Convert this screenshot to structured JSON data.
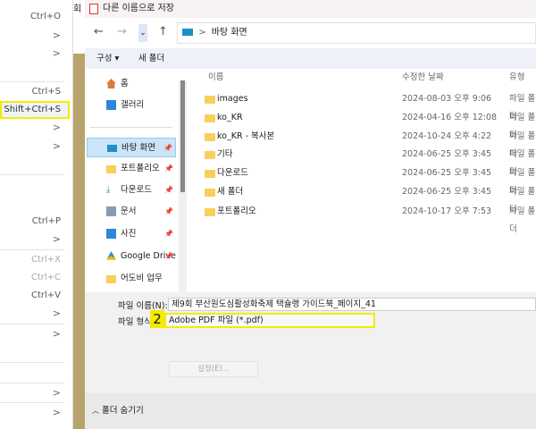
{
  "menu": {
    "items": [
      {
        "label": "Ctrl+O",
        "disabled": false
      },
      {
        "label": ">"
      },
      {
        "label": ">"
      },
      {
        "label": "Ctrl+S"
      },
      {
        "label": "Shift+Ctrl+S"
      },
      {
        "label": ">"
      },
      {
        "label": ">"
      },
      {
        "label": "Ctrl+P"
      },
      {
        "label": ">"
      },
      {
        "label": "Ctrl+X",
        "disabled": true
      },
      {
        "label": "Ctrl+C",
        "disabled": true
      },
      {
        "label": "Ctrl+V"
      },
      {
        "label": ">"
      },
      {
        "label": ">"
      },
      {
        "label": ">"
      },
      {
        "label": ">"
      }
    ]
  },
  "bg_fragment": "회",
  "dialog": {
    "title": "다른 이름으로 저장",
    "breadcrumb": {
      "sep": ">",
      "current": "바탕 화면"
    },
    "toolbar": {
      "organize": "구성 ▾",
      "new_folder": "새 폴더"
    },
    "nav_pane": [
      {
        "label": "홈",
        "icon": "home-icon"
      },
      {
        "label": "갤러리",
        "icon": "gallery-icon"
      },
      {
        "label": "바탕 화면",
        "icon": "desktop-icon",
        "pinned": true,
        "selected": true
      },
      {
        "label": "포트폴리오",
        "icon": "folder-icon",
        "pinned": true
      },
      {
        "label": "다운로드",
        "icon": "download-icon",
        "pinned": true
      },
      {
        "label": "문서",
        "icon": "document-icon",
        "pinned": true
      },
      {
        "label": "사진",
        "icon": "pictures-icon",
        "pinned": true
      },
      {
        "label": "Google Drive",
        "icon": "google-drive-icon",
        "pinned": true
      },
      {
        "label": "어도비 업무",
        "icon": "folder-icon"
      }
    ],
    "columns": {
      "name": "이름",
      "date": "수정한 날짜",
      "type": "유형"
    },
    "files": [
      {
        "name": "images",
        "date": "2024-08-03 오후 9:06",
        "type": "파일 폴더"
      },
      {
        "name": "ko_KR",
        "date": "2024-04-16 오후 12:08",
        "type": "파일 폴더"
      },
      {
        "name": "ko_KR - 복사본",
        "date": "2024-10-24 오후 4:22",
        "type": "파일 폴더"
      },
      {
        "name": "기타",
        "date": "2024-06-25 오후 3:45",
        "type": "파일 폴더"
      },
      {
        "name": "다운로드",
        "date": "2024-06-25 오후 3:45",
        "type": "파일 폴더"
      },
      {
        "name": "새 폴더",
        "date": "2024-06-25 오후 3:45",
        "type": "파일 폴더"
      },
      {
        "name": "포트폴리오",
        "date": "2024-10-17 오후 7:53",
        "type": "파일 폴더"
      }
    ],
    "filename_label": "파일 이름(N):",
    "filename_value": "제9회 부산원도심활성화축제 택슐랭 가이드북_페이지_41",
    "filetype_label": "파일 형식",
    "filetype_value": "Adobe PDF 파일 (*.pdf)",
    "step_badge": "2",
    "settings_button": "설정(E)...",
    "hide_folders": "폴더 숨기기"
  },
  "colors": {
    "highlight": "#f3ec00",
    "selected": "#cce4f7"
  }
}
